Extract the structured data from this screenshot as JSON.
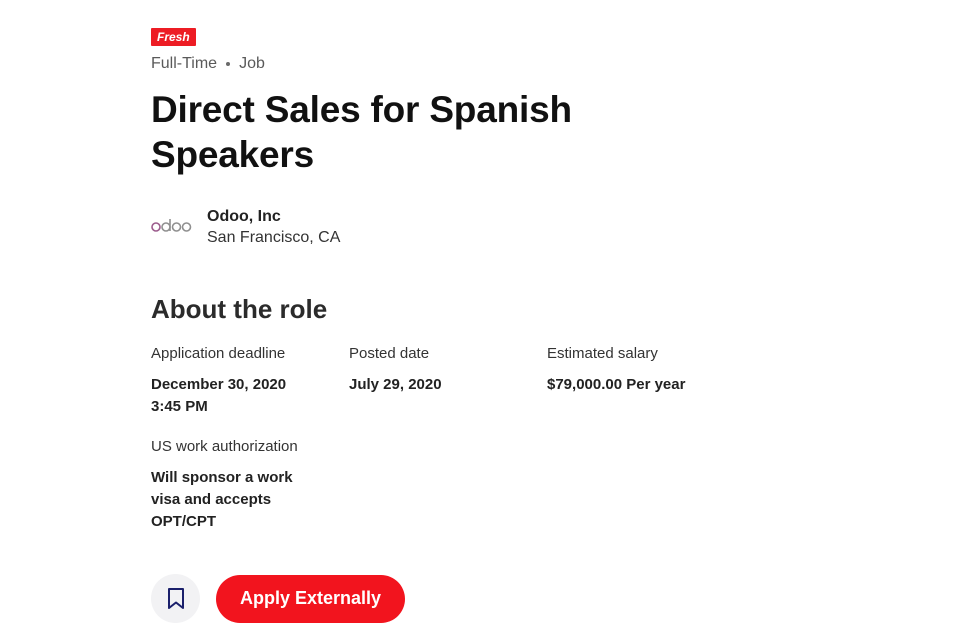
{
  "job": {
    "badge": "Fresh",
    "employment_type": "Full-Time",
    "category": "Job",
    "title": "Direct Sales for Spanish Speakers"
  },
  "employer": {
    "logo_text": "odoo",
    "name": "Odoo, Inc",
    "location": "San Francisco, CA"
  },
  "about": {
    "heading": "About the role",
    "fields": [
      {
        "label": "Application deadline",
        "value": "December 30, 2020 3:45 PM"
      },
      {
        "label": "Posted date",
        "value": "July 29, 2020"
      },
      {
        "label": "Estimated salary",
        "value": "$79,000.00 Per year"
      },
      {
        "label": "US work authorization",
        "value": "Will sponsor a work visa and accepts OPT/CPT"
      }
    ]
  },
  "actions": {
    "bookmark_icon": "bookmark-icon",
    "apply_label": "Apply Externally"
  },
  "colors": {
    "accent": "#f2141e",
    "badge": "#ed1c24",
    "logo_purple": "#9b5b8c",
    "logo_gray": "#8f8f8f",
    "bookmark_navy": "#1a1f6b"
  }
}
